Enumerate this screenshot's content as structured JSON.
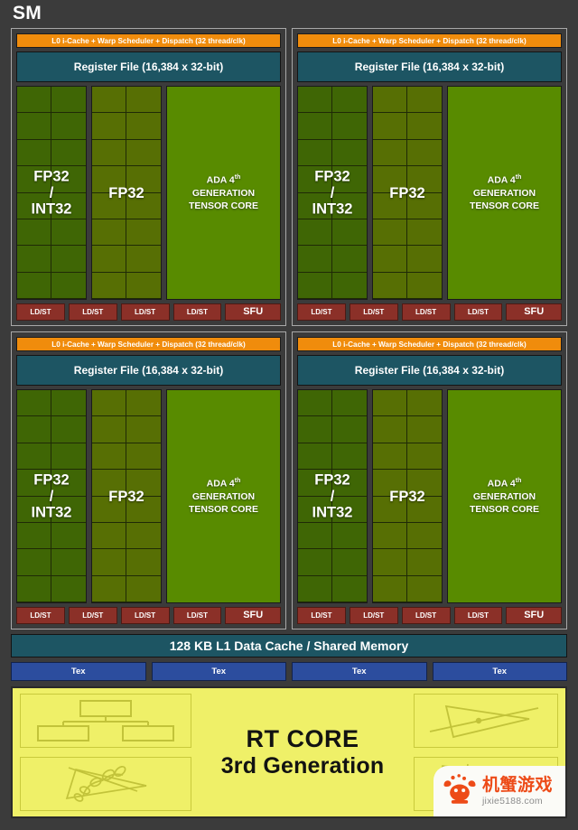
{
  "diagram": {
    "title": "SM",
    "subtitle_visible": false
  },
  "colors": {
    "background": "#3b3b3b",
    "scheduler_orange": "#f08c0c",
    "register_teal": "#1d5563",
    "fp32_int32_green": "#3f6605",
    "fp32_green": "#576f04",
    "tensor_green": "#588b00",
    "ldst_red": "#8b3028",
    "tex_blue": "#2c4d9e",
    "rt_core_yellow": "#eff068",
    "partition_border": "#a8a8a8",
    "watermark_orange": "#ed4b18"
  },
  "partitions": [
    {
      "id": "partition-0",
      "scheduler": "L0 i-Cache + Warp Scheduler + Dispatch (32 thread/clk)",
      "register_file": "Register File (16,384 x 32-bit)",
      "fp32_int32_label": "FP32\n/\nINT32",
      "fp32_int32_line1": "FP32",
      "fp32_int32_line2": "/",
      "fp32_int32_line3": "INT32",
      "fp32_label": "FP32",
      "tensor_line1": "ADA 4",
      "tensor_sup": "th",
      "tensor_line2": "GENERATION",
      "tensor_line3": "TENSOR CORE",
      "ldst_units": [
        "LD/ST",
        "LD/ST",
        "LD/ST",
        "LD/ST"
      ],
      "sfu": "SFU",
      "core_grid_columns": 2,
      "core_grid_rows": 8
    },
    {
      "id": "partition-1",
      "scheduler": "L0 i-Cache + Warp Scheduler + Dispatch (32 thread/clk)",
      "register_file": "Register File (16,384 x 32-bit)",
      "fp32_int32_line1": "FP32",
      "fp32_int32_line2": "/",
      "fp32_int32_line3": "INT32",
      "fp32_label": "FP32",
      "tensor_line1": "ADA 4",
      "tensor_sup": "th",
      "tensor_line2": "GENERATION",
      "tensor_line3": "TENSOR CORE",
      "ldst_units": [
        "LD/ST",
        "LD/ST",
        "LD/ST",
        "LD/ST"
      ],
      "sfu": "SFU",
      "core_grid_columns": 2,
      "core_grid_rows": 8
    },
    {
      "id": "partition-2",
      "scheduler": "L0 i-Cache + Warp Scheduler + Dispatch (32 thread/clk)",
      "register_file": "Register File (16,384 x 32-bit)",
      "fp32_int32_line1": "FP32",
      "fp32_int32_line2": "/",
      "fp32_int32_line3": "INT32",
      "fp32_label": "FP32",
      "tensor_line1": "ADA 4",
      "tensor_sup": "th",
      "tensor_line2": "GENERATION",
      "tensor_line3": "TENSOR CORE",
      "ldst_units": [
        "LD/ST",
        "LD/ST",
        "LD/ST",
        "LD/ST"
      ],
      "sfu": "SFU",
      "core_grid_columns": 2,
      "core_grid_rows": 8
    },
    {
      "id": "partition-3",
      "scheduler": "L0 i-Cache + Warp Scheduler + Dispatch (32 thread/clk)",
      "register_file": "Register File (16,384 x 32-bit)",
      "fp32_int32_line1": "FP32",
      "fp32_int32_line2": "/",
      "fp32_int32_line3": "INT32",
      "fp32_label": "FP32",
      "tensor_line1": "ADA 4",
      "tensor_sup": "th",
      "tensor_line2": "GENERATION",
      "tensor_line3": "TENSOR CORE",
      "ldst_units": [
        "LD/ST",
        "LD/ST",
        "LD/ST",
        "LD/ST"
      ],
      "sfu": "SFU",
      "core_grid_columns": 2,
      "core_grid_rows": 8
    }
  ],
  "l1_cache": {
    "label": "128 KB L1 Data Cache / Shared Memory"
  },
  "tex_units": [
    {
      "label": "Tex"
    },
    {
      "label": "Tex"
    },
    {
      "label": "Tex"
    },
    {
      "label": "Tex"
    }
  ],
  "rt_core": {
    "title_line1": "RT CORE",
    "title_line2": "3rd Generation",
    "panels": [
      {
        "name": "bvh-tree-diagram",
        "position": "top-left"
      },
      {
        "name": "foliage-triangle-diagram",
        "position": "bottom-left"
      },
      {
        "name": "ray-triangle-intersection-diagram",
        "position": "top-right"
      },
      {
        "name": "bvh-wireframe-diagram",
        "position": "bottom-right"
      }
    ]
  },
  "watermark": {
    "brand_cn": "机蟹游戏",
    "url": "jixie5188.com",
    "logo_name": "crab-logo"
  }
}
